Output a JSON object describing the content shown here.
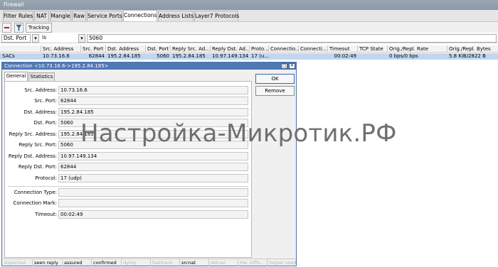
{
  "window": {
    "title": "Firewall"
  },
  "tabs": [
    {
      "label": "Filter Rules"
    },
    {
      "label": "NAT"
    },
    {
      "label": "Mangle"
    },
    {
      "label": "Raw"
    },
    {
      "label": "Service Ports"
    },
    {
      "label": "Connections"
    },
    {
      "label": "Address Lists"
    },
    {
      "label": "Layer7 Protocols"
    }
  ],
  "active_tab": "Connections",
  "toolbar": {
    "remove_icon": "minus-icon",
    "filter_icon": "filter-icon",
    "tracking_label": "Tracking"
  },
  "filter": {
    "field": "Dst. Port",
    "operator": "is",
    "value": "5060"
  },
  "table": {
    "columns": [
      "Src. Address",
      "Src. Port",
      "Dst. Address",
      "Dst. Port",
      "Reply Src. Ad...",
      "Reply Dst. Ad...",
      "Proto...",
      "Connectio...",
      "Connecti...",
      "Timeout",
      "TCP State",
      "Orig./Repl. Rate",
      "Orig./Repl. Bytes"
    ],
    "rows": [
      {
        "flags": "SACs",
        "cells": [
          "10.73.16.6",
          "62844",
          "195.2.84.185",
          "5060",
          "195.2.84.185",
          "10.97.149.134",
          "17 (u...",
          "",
          "",
          "00:02:49",
          "",
          "0 bps/0 bps",
          "5.8 KiB/2822 B"
        ]
      }
    ]
  },
  "dialog": {
    "title": "Connection <10.73.16.6->195.2.84.185>",
    "tabs": [
      "General",
      "Statistics"
    ],
    "active_tab": "General",
    "fields": [
      {
        "label": "Src. Address:",
        "value": "10.73.16.6"
      },
      {
        "label": "Src. Port:",
        "value": "62844"
      },
      {
        "label": "Dst. Address:",
        "value": "195.2.84.185"
      },
      {
        "label": "Dst. Port:",
        "value": "5060"
      },
      {
        "label": "Reply Src. Address:",
        "value": "195.2.84.185"
      },
      {
        "label": "Reply Src. Port:",
        "value": "5060"
      },
      {
        "label": "Reply Dst. Address:",
        "value": "10.97.149.134"
      },
      {
        "label": "Reply Dst. Port:",
        "value": "62844"
      },
      {
        "label": "Protocol:",
        "value": "17 (udp)"
      }
    ],
    "fields2": [
      {
        "label": "Connection Type:",
        "value": ""
      },
      {
        "label": "Connection Mark:",
        "value": ""
      },
      {
        "label": "Timeout:",
        "value": "00:02:49"
      }
    ],
    "buttons": {
      "ok": "OK",
      "remove": "Remove"
    },
    "status": [
      {
        "label": "expected",
        "on": false
      },
      {
        "label": "seen reply",
        "on": true
      },
      {
        "label": "assured",
        "on": true
      },
      {
        "label": "confirmed",
        "on": true
      },
      {
        "label": "dying",
        "on": false
      },
      {
        "label": "fasttrack",
        "on": false
      },
      {
        "label": "srcnat",
        "on": true
      },
      {
        "label": "dstnat",
        "on": false
      },
      {
        "label": "Hw. Offlo...",
        "on": false
      },
      {
        "label": "helper used",
        "on": false
      }
    ]
  },
  "watermark": "Настройка-Микротик.РФ"
}
